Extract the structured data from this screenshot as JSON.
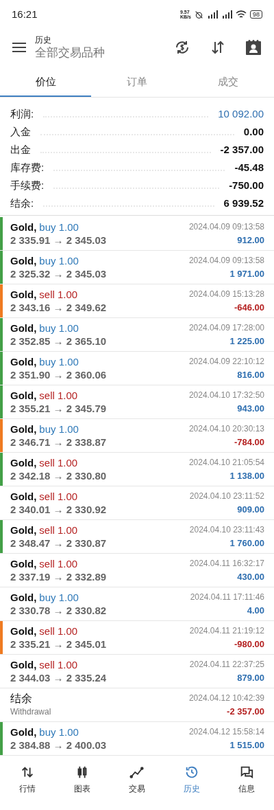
{
  "status_bar": {
    "time": "16:21",
    "speed": "9.57 KB/s",
    "battery": "98"
  },
  "header": {
    "title": "历史",
    "subtitle": "全部交易品种"
  },
  "tabs": [
    {
      "label": "价位",
      "selected": true
    },
    {
      "label": "订单",
      "selected": false
    },
    {
      "label": "成交",
      "selected": false
    }
  ],
  "summary": [
    {
      "label": "利润:",
      "value": "10 092.00",
      "highlight": true
    },
    {
      "label": "入金",
      "value": "0.00",
      "highlight": false
    },
    {
      "label": "出金",
      "value": "-2 357.00",
      "highlight": false
    },
    {
      "label": "库存费:",
      "value": "-45.48",
      "highlight": false
    },
    {
      "label": "手续费:",
      "value": "-750.00",
      "highlight": false
    },
    {
      "label": "结余:",
      "value": "6 939.52",
      "highlight": false
    }
  ],
  "deals": [
    {
      "kind": "buy",
      "symbol": "Gold,",
      "action": "buy 1.00",
      "prices": "2 335.91 → 2 345.03",
      "time": "2024.04.09 09:13:58",
      "profit": "912.00",
      "loss": false,
      "color": "#43a047"
    },
    {
      "kind": "buy",
      "symbol": "Gold,",
      "action": "buy 1.00",
      "prices": "2 325.32 → 2 345.03",
      "time": "2024.04.09 09:13:58",
      "profit": "1 971.00",
      "loss": false,
      "color": "#43a047"
    },
    {
      "kind": "sell",
      "symbol": "Gold,",
      "action": "sell 1.00",
      "prices": "2 343.16 → 2 349.62",
      "time": "2024.04.09 15:13:28",
      "profit": "-646.00",
      "loss": true,
      "color": "#ef7b22"
    },
    {
      "kind": "buy",
      "symbol": "Gold,",
      "action": "buy 1.00",
      "prices": "2 352.85 → 2 365.10",
      "time": "2024.04.09 17:28:00",
      "profit": "1 225.00",
      "loss": false,
      "color": "#43a047"
    },
    {
      "kind": "buy",
      "symbol": "Gold,",
      "action": "buy 1.00",
      "prices": "2 351.90 → 2 360.06",
      "time": "2024.04.09 22:10:12",
      "profit": "816.00",
      "loss": false,
      "color": "#43a047"
    },
    {
      "kind": "sell",
      "symbol": "Gold,",
      "action": "sell 1.00",
      "prices": "2 355.21 → 2 345.79",
      "time": "2024.04.10 17:32:50",
      "profit": "943.00",
      "loss": false,
      "color": "#43a047"
    },
    {
      "kind": "buy",
      "symbol": "Gold,",
      "action": "buy 1.00",
      "prices": "2 346.71 → 2 338.87",
      "time": "2024.04.10 20:30:13",
      "profit": "-784.00",
      "loss": true,
      "color": "#ef7b22"
    },
    {
      "kind": "sell",
      "symbol": "Gold,",
      "action": "sell 1.00",
      "prices": "2 342.18 → 2 330.80",
      "time": "2024.04.10 21:05:54",
      "profit": "1 138.00",
      "loss": false,
      "color": "#43a047"
    },
    {
      "kind": "sell",
      "symbol": "Gold,",
      "action": "sell 1.00",
      "prices": "2 340.01 → 2 330.92",
      "time": "2024.04.10 23:11:52",
      "profit": "909.00",
      "loss": false
    },
    {
      "kind": "sell",
      "symbol": "Gold,",
      "action": "sell 1.00",
      "prices": "2 348.47 → 2 330.87",
      "time": "2024.04.10 23:11:43",
      "profit": "1 760.00",
      "loss": false,
      "color": "#43a047"
    },
    {
      "kind": "sell",
      "symbol": "Gold,",
      "action": "sell 1.00",
      "prices": "2 337.19 → 2 332.89",
      "time": "2024.04.11 16:32:17",
      "profit": "430.00",
      "loss": false
    },
    {
      "kind": "buy",
      "symbol": "Gold,",
      "action": "buy 1.00",
      "prices": "2 330.78 → 2 330.82",
      "time": "2024.04.11 17:11:46",
      "profit": "4.00",
      "loss": false
    },
    {
      "kind": "sell",
      "symbol": "Gold,",
      "action": "sell 1.00",
      "prices": "2 335.21 → 2 345.01",
      "time": "2024.04.11 21:19:12",
      "profit": "-980.00",
      "loss": true,
      "color": "#ef7b22"
    },
    {
      "kind": "sell",
      "symbol": "Gold,",
      "action": "sell 1.00",
      "prices": "2 344.03 → 2 335.24",
      "time": "2024.04.11 22:37:25",
      "profit": "879.00",
      "loss": false
    },
    {
      "kind": "balance",
      "title": "结余",
      "note": "Withdrawal",
      "time": "2024.04.12 10:42:39",
      "profit": "-2 357.00",
      "loss": true
    },
    {
      "kind": "buy",
      "symbol": "Gold,",
      "action": "buy 1.00",
      "prices": "2 384.88 → 2 400.03",
      "time": "2024.04.12 15:58:14",
      "profit": "1 515.00",
      "loss": false,
      "color": "#43a047"
    }
  ],
  "nav": [
    {
      "label": "行情",
      "selected": false
    },
    {
      "label": "图表",
      "selected": false
    },
    {
      "label": "交易",
      "selected": false
    },
    {
      "label": "历史",
      "selected": true
    },
    {
      "label": "信息",
      "selected": false
    }
  ]
}
